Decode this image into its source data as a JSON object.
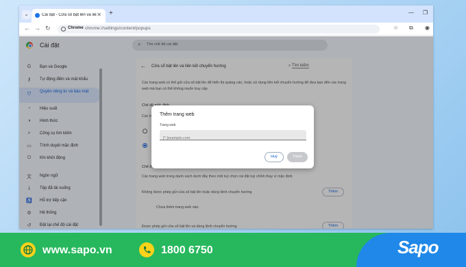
{
  "browser": {
    "tab_title": "Cài đặt - Cửa sổ bật lên và liên",
    "omnibox_chip": "Chrome",
    "url": "chrome://settings/content/popups"
  },
  "settings": {
    "title": "Cài đặt",
    "search_placeholder": "Tìm chế độ cài đặt",
    "sidebar": [
      {
        "label": "Bạn và Google",
        "icon": "google-icon"
      },
      {
        "label": "Tự động điền và mật khẩu",
        "icon": "key-icon"
      },
      {
        "label": "Quyền riêng tư và bảo mật",
        "icon": "shield-icon",
        "active": true
      },
      {
        "label": "Hiệu suất",
        "icon": "gauge-icon"
      },
      {
        "label": "Hình thức",
        "icon": "palette-icon"
      },
      {
        "label": "Công cụ tìm kiếm",
        "icon": "search-icon"
      },
      {
        "label": "Trình duyệt mặc định",
        "icon": "browser-icon"
      },
      {
        "label": "Khi khởi động",
        "icon": "power-icon"
      },
      {
        "label": "Ngôn ngữ",
        "icon": "translate-icon"
      },
      {
        "label": "Tệp đã tải xuống",
        "icon": "download-icon"
      },
      {
        "label": "Hỗ trợ tiếp cận",
        "icon": "accessibility-icon"
      },
      {
        "label": "Hệ thống",
        "icon": "wrench-icon"
      },
      {
        "label": "Đặt lại chế độ cài đặt",
        "icon": "reset-icon"
      }
    ],
    "page": {
      "title": "Cửa sổ bật lên và liên kết chuyển hướng",
      "search_link": "Tìm kiếm",
      "description": "Các trang web có thể gửi cửa sổ bật lên để hiển thị quảng cáo, hoặc sử dụng liên kết chuyển hướng để đưa bạn đến các trang web mà bạn có thể không muốn truy cập",
      "default_heading": "Chế độ mặc định",
      "default_sub": "Các trang",
      "custom_heading": "Chế đ",
      "custom_desc": "Các trang web trong danh sách dưới đây theo một tuỳ chọn cài đặt tuỳ chỉnh thay vì mặc định",
      "blocked_label": "Không được phép gửi cửa sổ bật lên hoặc dùng lệnh chuyển hướng",
      "blocked_add": "Thêm",
      "blocked_empty": "Chưa thêm trang web nào",
      "allowed_label": "Được phép gửi cửa sổ bật lên và dùng lệnh chuyển hướng",
      "allowed_add": "Thêm"
    },
    "dialog": {
      "title": "Thêm trang web",
      "field_label": "Trang web",
      "placeholder": "[*.]example.com",
      "cancel": "Huỷ",
      "add": "Thêm"
    }
  },
  "footer": {
    "website": "www.sapo.vn",
    "phone": "1800 6750",
    "brand": "Sapo"
  }
}
